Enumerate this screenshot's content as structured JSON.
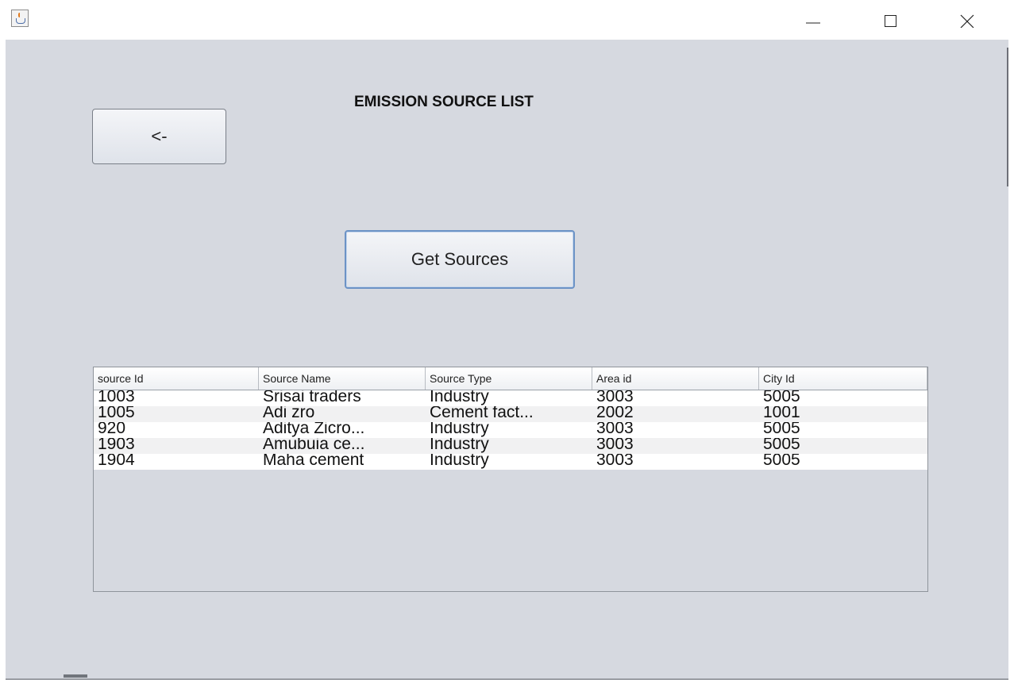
{
  "window": {
    "app_icon": "java-cup-icon",
    "controls": [
      "minimize-icon",
      "maximize-icon",
      "close-icon"
    ]
  },
  "page": {
    "title": "EMISSION SOURCE LIST",
    "back_label": "<-",
    "get_sources_label": "Get Sources"
  },
  "table": {
    "columns": [
      "source Id",
      "Source Name",
      "Source Type",
      "Area id",
      "City Id"
    ],
    "rows": [
      [
        "1003",
        "Srisai traders",
        "Industry",
        "3003",
        "5005"
      ],
      [
        "1005",
        "Adi zro",
        "Cement fact...",
        "2002",
        "1001"
      ],
      [
        "920",
        "Aditya Zicro...",
        "Industry",
        "3003",
        "5005"
      ],
      [
        "1903",
        "Amubuia ce...",
        "Industry",
        "3003",
        "5005"
      ],
      [
        "1904",
        "Maha cement",
        "Industry",
        "3003",
        "5005"
      ]
    ]
  },
  "colors": {
    "client_bg": "#d6d9e0",
    "focus_border": "#6c93c6"
  }
}
